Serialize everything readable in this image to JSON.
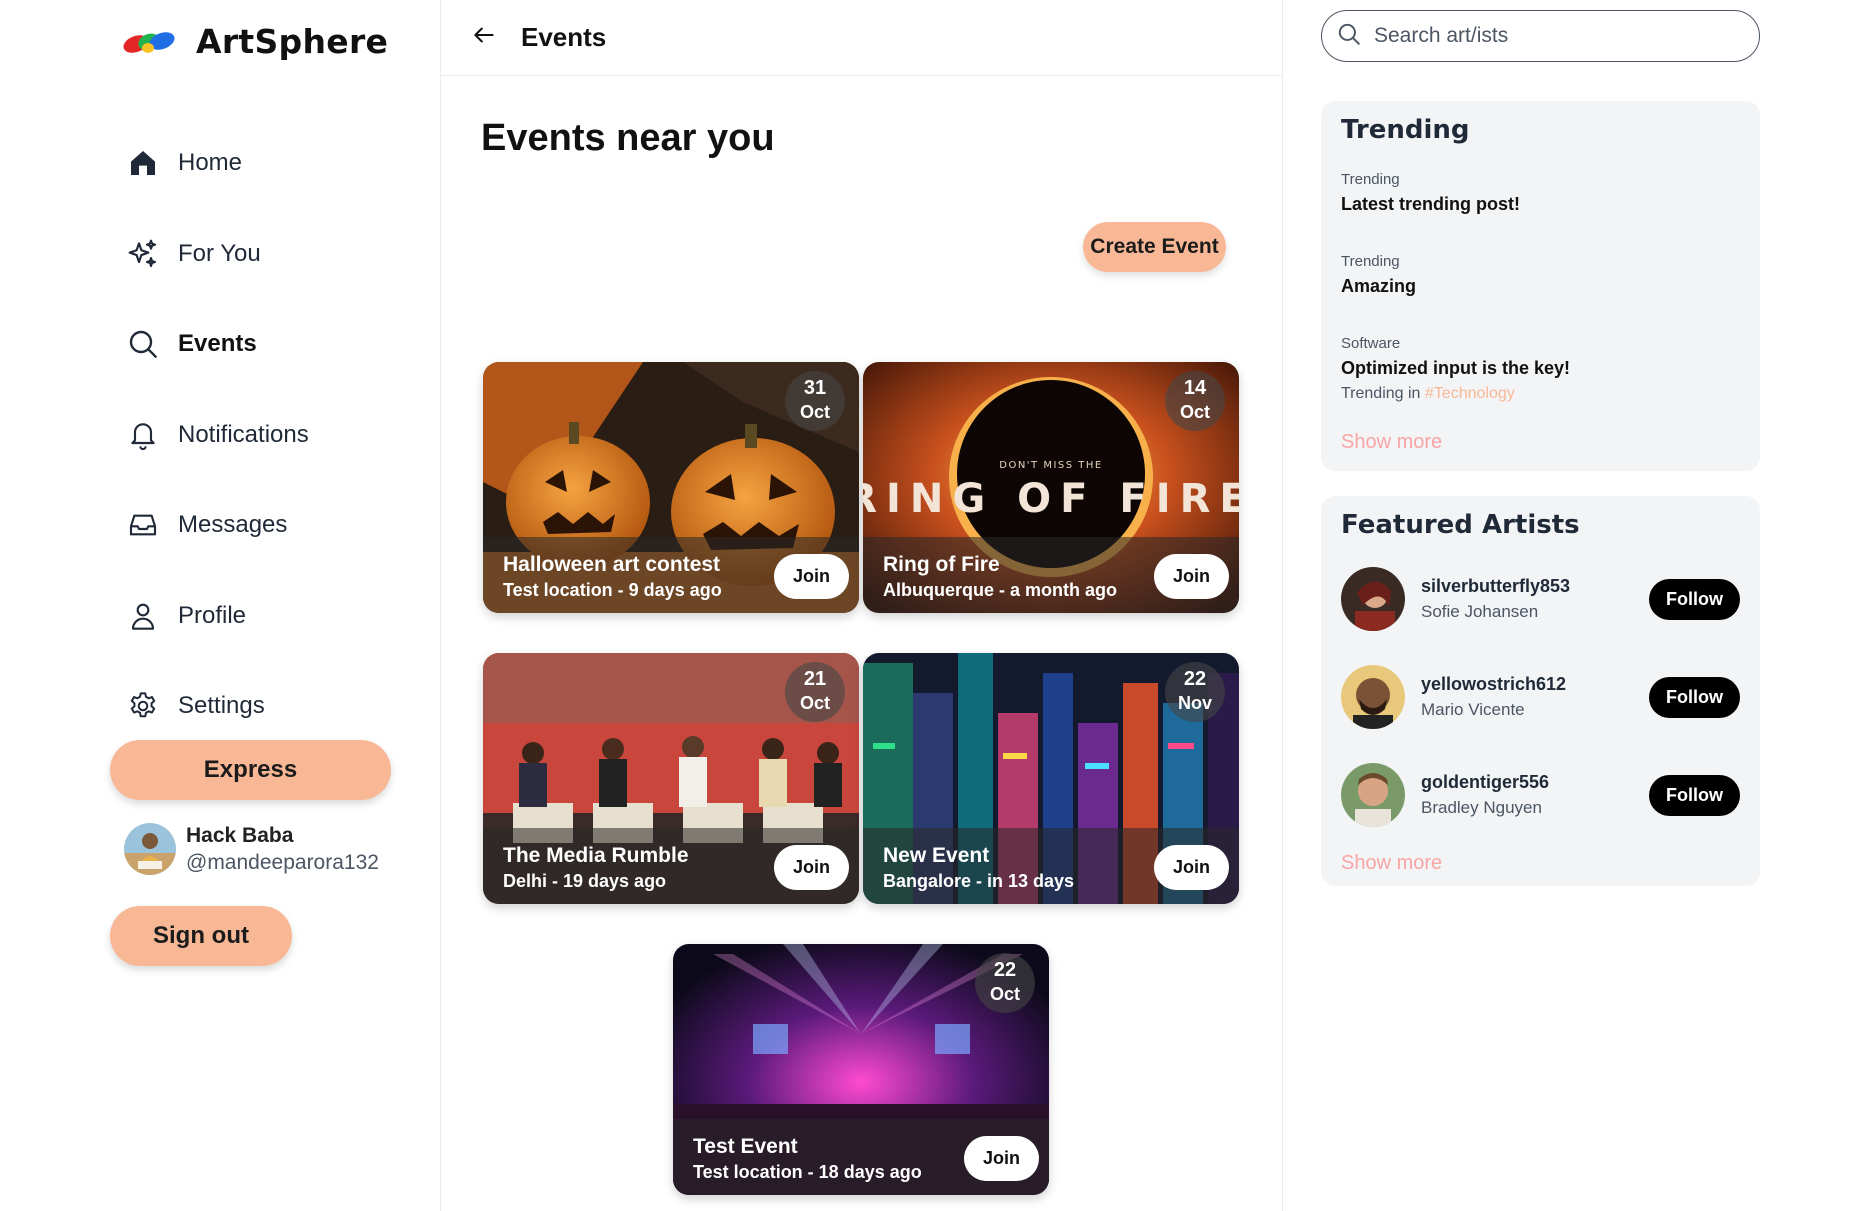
{
  "app": {
    "name": "ArtSphere"
  },
  "sidebar": {
    "items": [
      {
        "label": "Home",
        "icon": "home-icon"
      },
      {
        "label": "For You",
        "icon": "sparkles-icon"
      },
      {
        "label": "Events",
        "icon": "search-icon",
        "active": true
      },
      {
        "label": "Notifications",
        "icon": "bell-icon"
      },
      {
        "label": "Messages",
        "icon": "inbox-icon"
      },
      {
        "label": "Profile",
        "icon": "user-icon"
      },
      {
        "label": "Settings",
        "icon": "gear-icon"
      }
    ],
    "express_label": "Express",
    "user": {
      "name": "Hack Baba",
      "handle": "@mandeeparora132"
    },
    "signout_label": "Sign out"
  },
  "header": {
    "title": "Events"
  },
  "main": {
    "page_title": "Events near you",
    "create_label": "Create Event",
    "events": [
      {
        "name": "Halloween art contest",
        "meta": "Test location - 9 days ago",
        "day": "31",
        "month": "Oct",
        "join": "Join"
      },
      {
        "name": "Ring of Fire",
        "meta": "Albuquerque - a month ago",
        "day": "14",
        "month": "Oct",
        "join": "Join",
        "poster_small": "DON'T MISS THE",
        "poster_big": "RING OF FIRE"
      },
      {
        "name": "The Media Rumble",
        "meta": "Delhi - 19 days ago",
        "day": "21",
        "month": "Oct",
        "join": "Join"
      },
      {
        "name": "New Event",
        "meta": "Bangalore - in 13 days",
        "day": "22",
        "month": "Nov",
        "join": "Join"
      },
      {
        "name": "Test Event",
        "meta": "Test location - 18 days ago",
        "day": "22",
        "month": "Oct",
        "join": "Join"
      }
    ]
  },
  "right": {
    "search": {
      "placeholder": "Search art/ists"
    },
    "trending": {
      "title": "Trending",
      "items": [
        {
          "category": "Trending",
          "title": "Latest trending post!"
        },
        {
          "category": "Trending",
          "title": "Amazing"
        },
        {
          "category": "Software",
          "title": "Optimized input is the key!",
          "sub_prefix": "Trending in ",
          "sub_tag": "#Technology"
        }
      ],
      "show_more": "Show more"
    },
    "featured": {
      "title": "Featured Artists",
      "artists": [
        {
          "username": "silverbutterfly853",
          "name": "Sofie Johansen",
          "follow": "Follow"
        },
        {
          "username": "yellowostrich612",
          "name": "Mario Vicente",
          "follow": "Follow"
        },
        {
          "username": "goldentiger556",
          "name": "Bradley Nguyen",
          "follow": "Follow"
        }
      ],
      "show_more": "Show more"
    }
  },
  "colors": {
    "accent": "#f8b896",
    "link": "#f8a5a5",
    "panel": "#f3f4f6",
    "follow": "#000000"
  }
}
